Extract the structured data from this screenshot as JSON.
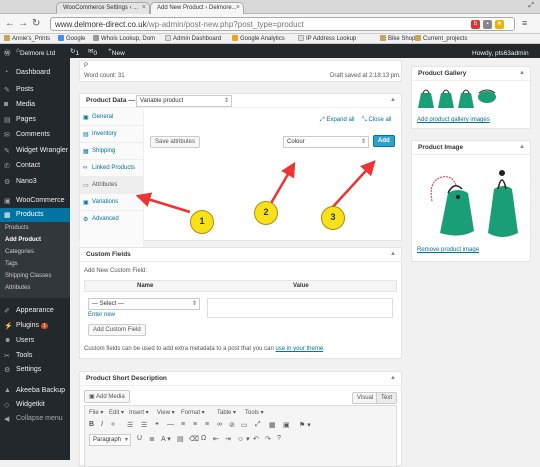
{
  "browser": {
    "tabs": [
      {
        "title": "WooCommerce Settings ‹ ..."
      },
      {
        "title": "Add New Product ‹ Delmore..."
      }
    ],
    "url_host": "www.delmore-direct.co.uk",
    "url_path": "/wp-admin/post-new.php?post_type=product",
    "bookmarks": [
      "Annie's_Prints",
      "Google",
      "Whois Lookup, Dom",
      "Admin Dashboard",
      "Google Analytics",
      "IP Address Lookup",
      "Bike Shop",
      "Current_projects"
    ]
  },
  "adminbar": {
    "site": "Delmore Ltd",
    "updates": "1",
    "comments": "0",
    "new": "New",
    "howdy": "Howdy, pts63admin"
  },
  "sidebar": {
    "items": [
      {
        "label": "Dashboard",
        "icon": "dashboard-icon"
      },
      {
        "label": "Posts",
        "icon": "pin-icon"
      },
      {
        "label": "Media",
        "icon": "media-icon"
      },
      {
        "label": "Pages",
        "icon": "page-icon"
      },
      {
        "label": "Comments",
        "icon": "comment-icon"
      },
      {
        "label": "Widget Wrangler",
        "icon": "pin-icon"
      },
      {
        "label": "Contact",
        "icon": "mail-icon"
      },
      {
        "label": "Nano3",
        "icon": "gear-icon"
      },
      {
        "label": "WooCommerce",
        "icon": "woo-icon"
      },
      {
        "label": "Products",
        "icon": "products-icon"
      }
    ],
    "submenu": [
      "Products",
      "Add Product",
      "Categories",
      "Tags",
      "Shipping Classes",
      "Attributes"
    ],
    "lower": [
      {
        "label": "Appearance",
        "icon": "brush-icon"
      },
      {
        "label": "Plugins",
        "icon": "plug-icon",
        "badge": "1"
      },
      {
        "label": "Users",
        "icon": "users-icon"
      },
      {
        "label": "Tools",
        "icon": "wrench-icon"
      },
      {
        "label": "Settings",
        "icon": "settings-icon"
      },
      {
        "label": "Akeeba Backup",
        "icon": "backup-icon"
      },
      {
        "label": "Widgetkit",
        "icon": "widgetkit-icon"
      },
      {
        "label": "Collapse menu",
        "icon": "collapse-icon"
      }
    ]
  },
  "editor_footer": {
    "p": "P",
    "word_count": "Word count: 31",
    "draft": "Draft saved at 2:18:13 pm."
  },
  "product_data": {
    "title": "Product Data —",
    "type": "Variable product",
    "tabs": [
      "General",
      "Inventory",
      "Shipping",
      "Linked Products",
      "Attributes",
      "Variations",
      "Advanced"
    ],
    "expand": "Expand all",
    "close": "Close all",
    "save_attributes": "Save attributes",
    "attribute_select": "Colour",
    "add": "Add"
  },
  "callouts": [
    "1",
    "2",
    "3"
  ],
  "custom_fields": {
    "title": "Custom Fields",
    "add_new": "Add New Custom Field:",
    "col_name": "Name",
    "col_value": "Value",
    "select": "— Select —",
    "enter_new": "Enter new",
    "add_button": "Add Custom Field",
    "note": "Custom fields can be used to add extra metadata to a post that you can",
    "note_link": "use in your theme",
    "note_end": "."
  },
  "short_desc": {
    "title": "Product Short Description",
    "add_media": "Add Media",
    "visual": "Visual",
    "text": "Text",
    "menus": [
      "File",
      "Edit",
      "Insert",
      "View",
      "Format",
      "Table",
      "Tools"
    ],
    "paragraph": "Paragraph"
  },
  "gallery": {
    "title": "Product Gallery",
    "add_link": "Add product gallery images"
  },
  "product_image": {
    "title": "Product Image",
    "remove_link": "Remove product image"
  }
}
